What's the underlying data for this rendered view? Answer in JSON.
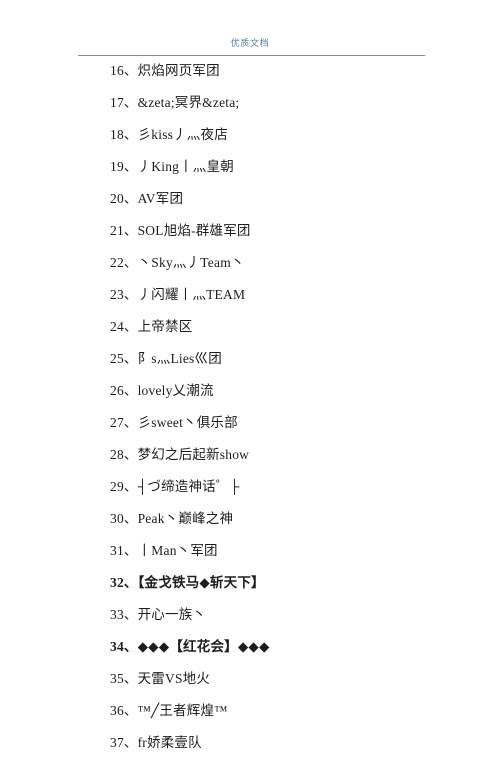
{
  "header": {
    "title": "优质文档",
    "title_color": "#5b7ba8",
    "rule_color": "#8a8a8a"
  },
  "document": {
    "background_color": "#ffffff",
    "text_color": "#1d1d1d",
    "items": [
      {
        "number": "16",
        "text": "16、炽焰网页军团",
        "bold": false
      },
      {
        "number": "17",
        "text": "17、&zeta;冥界&zeta;",
        "bold": false
      },
      {
        "number": "18",
        "text": "18、彡kiss丿灬夜店",
        "bold": false
      },
      {
        "number": "19",
        "text": "19、丿King丨灬皇朝",
        "bold": false
      },
      {
        "number": "20",
        "text": "20、AV军团",
        "bold": false
      },
      {
        "number": "21",
        "text": "21、SOL旭焰-群雄军团",
        "bold": false
      },
      {
        "number": "22",
        "text": "22、丶Sky灬丿Team丶",
        "bold": false
      },
      {
        "number": "23",
        "text": "23、丿闪耀丨灬TEAM",
        "bold": false
      },
      {
        "number": "24",
        "text": "24、上帝禁区",
        "bold": false
      },
      {
        "number": "25",
        "text": "25、阝s灬Lies巛团",
        "bold": false
      },
      {
        "number": "26",
        "text": "26、lovely乂潮流",
        "bold": false
      },
      {
        "number": "27",
        "text": "27、彡sweet丶俱乐部",
        "bold": false
      },
      {
        "number": "28",
        "text": "28、梦幻之后起新show",
        "bold": false
      },
      {
        "number": "29",
        "text": "29、┤づ缔造神话゜├",
        "bold": false
      },
      {
        "number": "30",
        "text": "30、Peak丶巅峰之神",
        "bold": false
      },
      {
        "number": "31",
        "text": "31、丨Man丶军团",
        "bold": false
      },
      {
        "number": "32",
        "text": "32、【金戈铁马◆斩天下】",
        "bold": true
      },
      {
        "number": "33",
        "text": "33、开心一族丶",
        "bold": false
      },
      {
        "number": "34",
        "text": "34、◆◆◆【红花会】◆◆◆",
        "bold": true
      },
      {
        "number": "35",
        "text": "35、天雷VS地火",
        "bold": false
      },
      {
        "number": "36",
        "text": "36、™╱王者辉煌™",
        "bold": false
      },
      {
        "number": "37",
        "text": "37、fr娇柔壹队",
        "bold": false
      }
    ]
  }
}
